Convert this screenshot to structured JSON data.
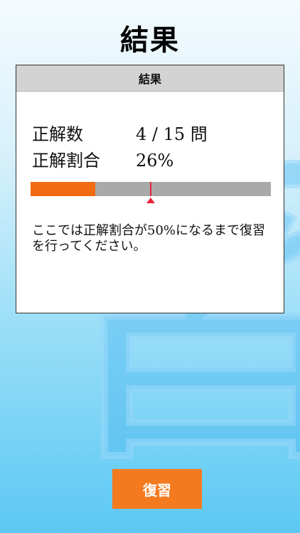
{
  "page": {
    "title": "結果"
  },
  "background": {
    "glyph": "習"
  },
  "card": {
    "header": "結果",
    "correct_count_label": "正解数",
    "correct_count_value": "4 / 15 問",
    "correct_rate_label": "正解割合",
    "correct_rate_value": "26%",
    "progress": {
      "fraction": 0.27,
      "target_fraction": 0.5,
      "fill_color": "#f26a12",
      "track_color": "#a9a9a9",
      "target_color": "#e8243c"
    },
    "message": "ここでは正解割合が50%になるまで復習を行ってください。"
  },
  "actions": {
    "review_label": "復習",
    "review_color": "#f47a20"
  }
}
